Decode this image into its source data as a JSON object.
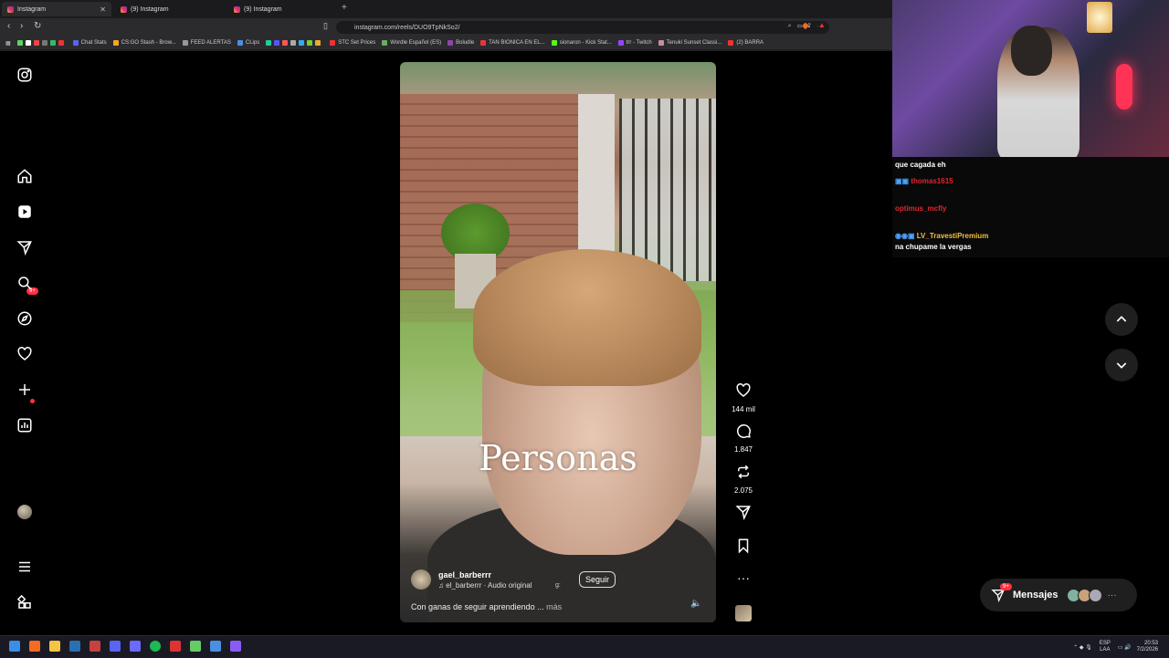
{
  "browser": {
    "tabs": [
      {
        "label": "Instagram",
        "active": true
      },
      {
        "label": "(9) Instagram",
        "active": false
      },
      {
        "label": "(9) Instagram",
        "active": false
      }
    ],
    "url": "instagram.com/reels/DUO9TpNkSo2/",
    "bookmarks": [
      "Chat Stats",
      "CS:GO Stash - Brow...",
      "FEED ALERTAS",
      "CLips",
      "STC Set Prices",
      "Wordle Español (ES)",
      "Boludle",
      "TAN BIONICA EN EL...",
      "sionaron - Kick Stat...",
      "trr - Twitch",
      "Tenuki Sunset Classi...",
      "(2) BARRA"
    ]
  },
  "sidebar": {
    "notifications_badge": "9+"
  },
  "reel": {
    "overlay_word": "Personas",
    "username": "gael_barberrr",
    "audio": "gael_barberrr · Audio original",
    "audio_visible": "♫ el_barberrr · Audio original",
    "follow_label": "Seguir",
    "extra_text": "g:",
    "description": "Con ganas de seguir aprendiendo ...",
    "more_label": "más"
  },
  "actions": {
    "likes": "144 mil",
    "comments": "1.847",
    "reposts": "2.075"
  },
  "messages": {
    "label": "Mensajes",
    "badge": "9+"
  },
  "chat": {
    "lines": [
      {
        "user": "",
        "text": "que cagada eh",
        "color": "#ffffff"
      },
      {
        "user": "thomas1615",
        "text": "",
        "color": "#e2242e"
      },
      {
        "user": "optimus_mcfly",
        "text": "",
        "color": "#e2242e"
      },
      {
        "user": "LV_TravestiPremium",
        "text": "",
        "color": "#f0c040"
      },
      {
        "user": "",
        "text": "na chupame la vergas",
        "color": "#ffffff"
      }
    ]
  },
  "taskbar": {
    "lang": "ESP",
    "lang2": "LAA",
    "time": "20:53",
    "date": "7/2/2026"
  },
  "colors": {
    "badge": "#ff3040",
    "panel": "#1f1f1f"
  }
}
